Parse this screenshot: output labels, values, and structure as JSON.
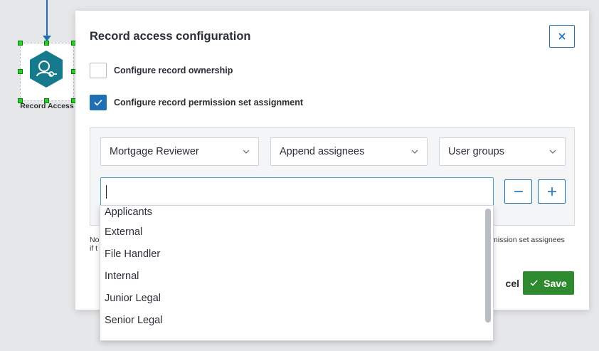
{
  "canvas": {
    "node_label": "Record Access"
  },
  "modal": {
    "title": "Record access configuration",
    "close_label": "×",
    "options": [
      {
        "label": "Configure record ownership",
        "checked": false
      },
      {
        "label": "Configure record permission set assignment",
        "checked": true
      }
    ],
    "assignment": {
      "permission_set": "Mortgage Reviewer",
      "mode": "Append assignees",
      "assignee_type": "User groups",
      "search_value": "",
      "remove_label": "−",
      "add_label": "+"
    },
    "note_left_1": "No",
    "note_left_2": "if t",
    "note_right": "mission set assignees",
    "cancel_label": "cel",
    "save_label": "Save"
  },
  "dropdown": {
    "items": [
      "Applicants",
      "External",
      "File Handler",
      "Internal",
      "Junior Legal",
      "Senior Legal"
    ]
  },
  "colors": {
    "accent": "#1f6fb5",
    "save": "#2e8a2e",
    "node": "#157a8c"
  }
}
